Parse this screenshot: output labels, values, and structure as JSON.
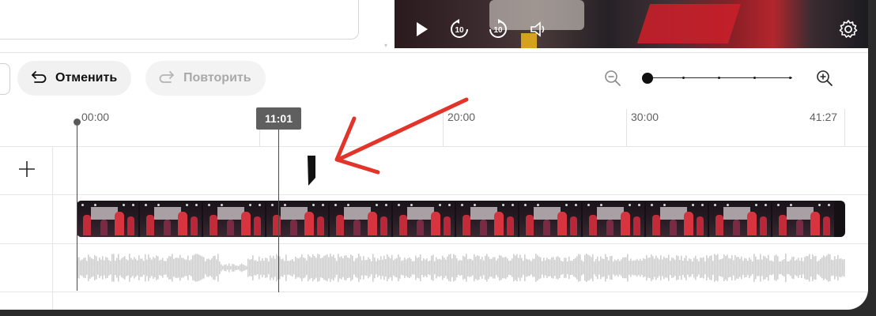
{
  "toolbar": {
    "undo_label": "Отменить",
    "redo_label": "Повторить",
    "undo_icon": "undo-arrow-icon",
    "redo_icon": "redo-arrow-icon"
  },
  "player": {
    "controls": [
      "play-icon",
      "rewind-10-icon",
      "forward-10-icon",
      "volume-icon",
      "settings-gear-icon"
    ],
    "rewind_label": "10",
    "forward_label": "10"
  },
  "zoom": {
    "zoom_out_icon": "zoom-out-icon",
    "zoom_in_icon": "zoom-in-icon",
    "level": 0
  },
  "timeline": {
    "ruler": {
      "start": "00:00",
      "t20": "20:00",
      "t30": "30:00",
      "end": "41:27"
    },
    "playhead_time": "11:01",
    "add_track_icon": "plus-icon",
    "clip_thumbnail_count": 12
  },
  "annotation": {
    "arrow_color": "#e3342a"
  },
  "colors": {
    "accent": "#0f0f0f",
    "disabled_text": "#a9a9a9",
    "playhead_badge": "#5f5f5f",
    "waveform": "#cfcfcf"
  }
}
